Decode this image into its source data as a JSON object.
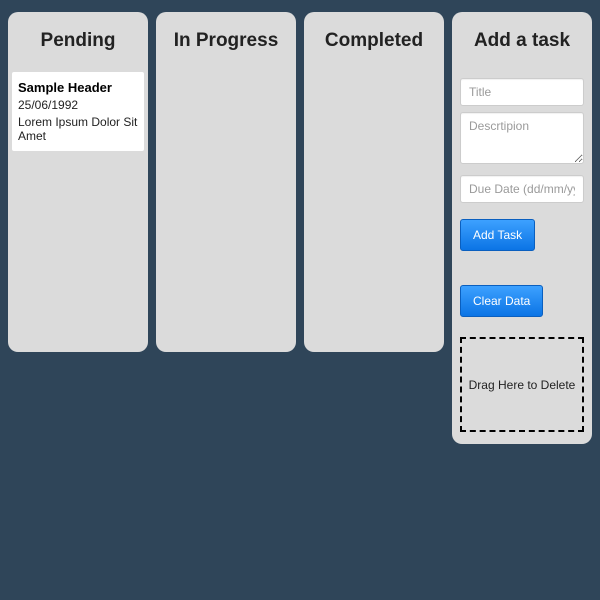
{
  "columns": {
    "pending": {
      "title": "Pending"
    },
    "in_progress": {
      "title": "In Progress"
    },
    "completed": {
      "title": "Completed"
    }
  },
  "tasks": {
    "pending": [
      {
        "title": "Sample Header",
        "date": "25/06/1992",
        "body": "Lorem Ipsum Dolor Sit Amet"
      }
    ]
  },
  "sidebar": {
    "title": "Add a task",
    "title_placeholder": "Title",
    "description_placeholder": "Descrtipion",
    "duedate_placeholder": "Due Date (dd/mm/yyyy)",
    "add_button": "Add Task",
    "clear_button": "Clear Data",
    "delete_zone": "Drag Here to Delete"
  }
}
